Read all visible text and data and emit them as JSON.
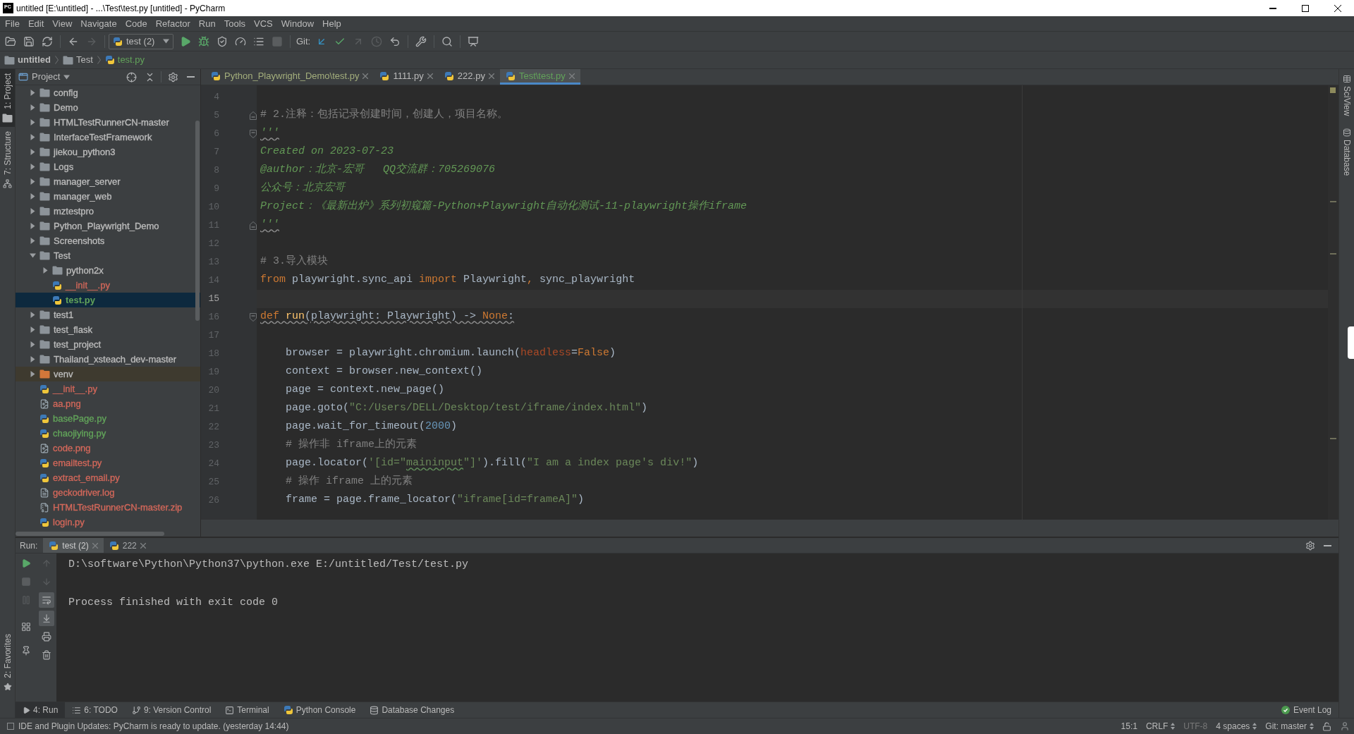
{
  "window": {
    "logo": "PC",
    "title": "untitled [E:\\untitled] - ...\\Test\\test.py [untitled] - PyCharm"
  },
  "menu": [
    "File",
    "Edit",
    "View",
    "Navigate",
    "Code",
    "Refactor",
    "Run",
    "Tools",
    "VCS",
    "Window",
    "Help"
  ],
  "toolbar": {
    "file_buttons": [
      {
        "disabled": false
      },
      {
        "disabled": false
      },
      {
        "disabled": false
      }
    ],
    "history_buttons": [
      {
        "disabled": false
      },
      {
        "disabled": true
      }
    ],
    "run_configuration": "test (2)",
    "run_buttons": [
      {
        "disabled": false
      },
      {
        "disabled": false
      },
      {
        "disabled": false
      },
      {
        "disabled": false
      },
      {
        "disabled": false
      },
      {
        "disabled": true
      }
    ],
    "vcs_label": "Git:",
    "vcs_buttons": [
      {
        "disabled": false
      },
      {
        "disabled": false
      },
      {
        "disabled": true
      },
      {
        "disabled": true
      },
      {
        "disabled": false
      }
    ],
    "tool_buttons": [
      {
        "disabled": false
      },
      {
        "disabled": false
      },
      {
        "disabled": false
      }
    ]
  },
  "navigation_bar": [
    {
      "label": "untitled",
      "kind": "project",
      "color": "#bbbbbb"
    },
    {
      "label": "Test",
      "kind": "folder",
      "color": "#bbbbbb"
    },
    {
      "label": "test.py",
      "kind": "python",
      "color": "#62a35a"
    }
  ],
  "tool_strip_left": {
    "top": [
      {
        "label": "1: Project",
        "selected": true
      },
      {
        "label": "7: Structure",
        "selected": false
      }
    ],
    "bottom": [
      {
        "label": "2: Favorites",
        "selected": false
      }
    ]
  },
  "project_panel": {
    "title": "Project",
    "tree": [
      {
        "label": "config",
        "kind": "folder",
        "color": "#bbbbbb",
        "expanded": false,
        "selected": false
      },
      {
        "label": "Demo",
        "kind": "folder",
        "color": "#bbbbbb",
        "expanded": false,
        "selected": false
      },
      {
        "label": "HTMLTestRunnerCN-master",
        "kind": "folder",
        "color": "#bbbbbb",
        "expanded": false,
        "selected": false
      },
      {
        "label": "InterfaceTestFramework",
        "kind": "folder",
        "color": "#bbbbbb",
        "expanded": false,
        "selected": false
      },
      {
        "label": "jiekou_python3",
        "kind": "folder",
        "color": "#bbbbbb",
        "expanded": false,
        "selected": false
      },
      {
        "label": "Logs",
        "kind": "folder",
        "color": "#bbbbbb",
        "expanded": false,
        "selected": false
      },
      {
        "label": "manager_server",
        "kind": "folder",
        "color": "#bbbbbb",
        "expanded": false,
        "selected": false
      },
      {
        "label": "manager_web",
        "kind": "folder",
        "color": "#bbbbbb",
        "expanded": false,
        "selected": false
      },
      {
        "label": "mztestpro",
        "kind": "folder",
        "color": "#bbbbbb",
        "expanded": false,
        "selected": false
      },
      {
        "label": "Python_Playwright_Demo",
        "kind": "folder",
        "color": "#bbbbbb",
        "expanded": false,
        "selected": false
      },
      {
        "label": "Screenshots",
        "kind": "folder",
        "color": "#bbbbbb",
        "expanded": false,
        "selected": false
      },
      {
        "label": "Test",
        "kind": "folder",
        "color": "#bbbbbb",
        "expanded": true,
        "selected": false,
        "children": [
          {
            "label": "python2x",
            "kind": "folder",
            "color": "#bbbbbb",
            "expanded": false,
            "selected": false
          },
          {
            "label": "__init__.py",
            "kind": "python",
            "color": "#d1675a",
            "selected": false
          },
          {
            "label": "test.py",
            "kind": "python",
            "color": "#62a35a",
            "selected": true
          }
        ]
      },
      {
        "label": "test1",
        "kind": "folder",
        "color": "#bbbbbb",
        "expanded": false,
        "selected": false
      },
      {
        "label": "test_flask",
        "kind": "folder",
        "color": "#bbbbbb",
        "expanded": false,
        "selected": false
      },
      {
        "label": "test_project",
        "kind": "folder",
        "color": "#bbbbbb",
        "expanded": false,
        "selected": false
      },
      {
        "label": "Thailand_xsteach_dev-master",
        "kind": "folder",
        "color": "#bbbbbb",
        "expanded": false,
        "selected": false
      },
      {
        "label": "venv",
        "kind": "excluded-folder",
        "color": "#bbbbbb",
        "expanded": false,
        "selected": false
      },
      {
        "label": "__init__.py",
        "kind": "python",
        "color": "#d1675a",
        "selected": false
      },
      {
        "label": "aa.png",
        "kind": "image",
        "color": "#d1675a",
        "selected": false
      },
      {
        "label": "basePage.py",
        "kind": "python",
        "color": "#62a35a",
        "selected": false
      },
      {
        "label": "chaojiying.py",
        "kind": "python",
        "color": "#62a35a",
        "selected": false
      },
      {
        "label": "code.png",
        "kind": "image",
        "color": "#d1675a",
        "selected": false
      },
      {
        "label": "emailtest.py",
        "kind": "python",
        "color": "#d1675a",
        "selected": false
      },
      {
        "label": "extract_email.py",
        "kind": "python",
        "color": "#d1675a",
        "selected": false
      },
      {
        "label": "geckodriver.log",
        "kind": "text",
        "color": "#d1675a",
        "selected": false
      },
      {
        "label": "HTMLTestRunnerCN-master.zip",
        "kind": "archive",
        "color": "#d1675a",
        "selected": false
      },
      {
        "label": "login.py",
        "kind": "python",
        "color": "#d1675a",
        "selected": false
      }
    ]
  },
  "editor": {
    "tabs": [
      {
        "label": "Python_Playwright_Demo\\test.py",
        "color": "#a3ae7c",
        "selected": false
      },
      {
        "label": "1111.py",
        "color": "#bbbbbb",
        "selected": false
      },
      {
        "label": "222.py",
        "color": "#bbbbbb",
        "selected": false
      },
      {
        "label": "Test\\test.py",
        "color": "#62a35a",
        "selected": true
      }
    ],
    "lines": [
      {
        "number": "4",
        "current": false
      },
      {
        "number": "5",
        "current": false,
        "fold_marker": {
          "kind": "end"
        },
        "tokens": [
          {
            "text": "# 2.注释：包括记录创建时间，创建人，项目名称。",
            "kind": "comment",
            "warning": false
          }
        ]
      },
      {
        "number": "6",
        "current": false,
        "fold_marker": {
          "kind": "start"
        },
        "tokens": [
          {
            "text": "'''",
            "kind": "docstring",
            "warning": true
          }
        ]
      },
      {
        "number": "7",
        "current": false,
        "tokens": [
          {
            "text": "Created on 2023-07-23",
            "kind": "docstring",
            "warning": false
          }
        ]
      },
      {
        "number": "8",
        "current": false,
        "tokens": [
          {
            "text": "@author：北京-宏哥   QQ交流群：705269076",
            "kind": "docstring",
            "warning": false
          }
        ]
      },
      {
        "number": "9",
        "current": false,
        "tokens": [
          {
            "text": "公众号：北京宏哥",
            "kind": "docstring",
            "warning": false
          }
        ]
      },
      {
        "number": "10",
        "current": false,
        "tokens": [
          {
            "text": "Project：《最新出炉》系列初窥篇-Python+Playwright自动化测试-11-playwright操作iframe",
            "kind": "docstring",
            "warning": false
          }
        ]
      },
      {
        "number": "11",
        "current": false,
        "fold_marker": {
          "kind": "end"
        },
        "tokens": [
          {
            "text": "'''",
            "kind": "docstring",
            "warning": true
          }
        ]
      },
      {
        "number": "12",
        "current": false
      },
      {
        "number": "13",
        "current": false,
        "tokens": [
          {
            "text": "# 3.导入模块",
            "kind": "comment",
            "warning": false
          }
        ]
      },
      {
        "number": "14",
        "current": false,
        "tokens": [
          {
            "text": "from",
            "kind": "keyword",
            "warning": false
          },
          {
            "text": " playwright.sync_api ",
            "kind": "plain",
            "warning": false
          },
          {
            "text": "import",
            "kind": "keyword",
            "warning": false
          },
          {
            "text": " Playwright",
            "kind": "plain",
            "warning": false
          },
          {
            "text": ",",
            "kind": "punct",
            "warning": false
          },
          {
            "text": " sync_playwright",
            "kind": "plain",
            "warning": false
          }
        ]
      },
      {
        "number": "15",
        "current": true
      },
      {
        "number": "16",
        "current": false,
        "fold_marker": {
          "kind": "start"
        },
        "tokens": [
          {
            "text": "def ",
            "kind": "keyword",
            "warning": true
          },
          {
            "text": "run",
            "kind": "function",
            "warning": true
          },
          {
            "text": "(playwright: Playwright) -> ",
            "kind": "plain",
            "warning": true
          },
          {
            "text": "None",
            "kind": "keyword",
            "warning": true
          },
          {
            "text": ":",
            "kind": "plain",
            "warning": true
          }
        ]
      },
      {
        "number": "17",
        "current": false
      },
      {
        "number": "18",
        "current": false,
        "tokens": [
          {
            "text": "    browser = playwright.chromium.launch(",
            "kind": "plain",
            "warning": false
          },
          {
            "text": "headless",
            "kind": "param",
            "warning": false
          },
          {
            "text": "=",
            "kind": "plain",
            "warning": false
          },
          {
            "text": "False",
            "kind": "keyword",
            "warning": false
          },
          {
            "text": ")",
            "kind": "plain",
            "warning": false
          }
        ]
      },
      {
        "number": "19",
        "current": false,
        "tokens": [
          {
            "text": "    context = browser.new_context()",
            "kind": "plain",
            "warning": false
          }
        ]
      },
      {
        "number": "20",
        "current": false,
        "tokens": [
          {
            "text": "    page = context.new_page()",
            "kind": "plain",
            "warning": false
          }
        ]
      },
      {
        "number": "21",
        "current": false,
        "tokens": [
          {
            "text": "    page.goto(",
            "kind": "plain",
            "warning": false
          },
          {
            "text": "\"C:/Users/DELL/Desktop/test/iframe/index.html\"",
            "kind": "string",
            "warning": false
          },
          {
            "text": ")",
            "kind": "plain",
            "warning": false
          }
        ]
      },
      {
        "number": "22",
        "current": false,
        "tokens": [
          {
            "text": "    page.wait_for_timeout(",
            "kind": "plain",
            "warning": false
          },
          {
            "text": "2000",
            "kind": "number",
            "warning": false
          },
          {
            "text": ")",
            "kind": "plain",
            "warning": false
          }
        ]
      },
      {
        "number": "23",
        "current": false,
        "tokens": [
          {
            "text": "    # 操作非 iframe上的元素",
            "kind": "comment",
            "warning": false
          }
        ]
      },
      {
        "number": "24",
        "current": false,
        "tokens": [
          {
            "text": "    page.locator(",
            "kind": "plain",
            "warning": false
          },
          {
            "text": "'[id=\"",
            "kind": "string",
            "warning": false
          },
          {
            "text": "maininput",
            "kind": "string",
            "warning": true
          },
          {
            "text": "\"]'",
            "kind": "string",
            "warning": false
          },
          {
            "text": ").fill(",
            "kind": "plain",
            "warning": false
          },
          {
            "text": "\"I am a index page's div!\"",
            "kind": "string",
            "warning": false
          },
          {
            "text": ")",
            "kind": "plain",
            "warning": false
          }
        ]
      },
      {
        "number": "25",
        "current": false,
        "tokens": [
          {
            "text": "    # 操作 iframe 上的元素",
            "kind": "comment",
            "warning": false
          }
        ]
      },
      {
        "number": "26",
        "current": false,
        "tokens": [
          {
            "text": "    frame = page.frame_locator(",
            "kind": "plain",
            "warning": false
          },
          {
            "text": "\"iframe[id=frameA]\"",
            "kind": "string",
            "warning": false
          },
          {
            "text": ")",
            "kind": "plain",
            "warning": false
          }
        ]
      }
    ]
  },
  "tool_strip_right": [
    {
      "label": "SciView"
    },
    {
      "label": "Database"
    }
  ],
  "run_panel": {
    "label": "Run:",
    "tabs": [
      {
        "label": "test (2)",
        "selected": true
      },
      {
        "label": "222",
        "selected": false
      }
    ],
    "controls": [
      {
        "disabled": false
      },
      {
        "disabled": true
      },
      {
        "disabled": true
      },
      {
        "disabled": false
      },
      {
        "disabled": false
      }
    ],
    "options": [
      {
        "disabled": true,
        "on": false
      },
      {
        "disabled": true,
        "on": false
      },
      {
        "disabled": false,
        "on": true
      },
      {
        "disabled": false,
        "on": true
      },
      {
        "disabled": false,
        "on": false
      },
      {
        "disabled": false,
        "on": false
      }
    ],
    "console": [
      {
        "text": "D:\\software\\Python\\Python37\\python.exe E:/untitled/Test/test.py",
        "kind": "command"
      },
      {
        "text": "Process finished with exit code 0",
        "kind": "exit"
      }
    ]
  },
  "tool_window_bar": {
    "items": [
      {
        "label": "4: Run",
        "selected": true
      },
      {
        "label": "6: TODO",
        "selected": false
      },
      {
        "label": "9: Version Control",
        "selected": false
      },
      {
        "label": "Terminal",
        "selected": false
      },
      {
        "label": "Python Console",
        "selected": false
      },
      {
        "label": "Database Changes",
        "selected": false
      }
    ],
    "event_log": "Event Log"
  },
  "status_bar": {
    "message": "IDE and Plugin Updates: PyCharm is ready to update. (yesterday 14:44)",
    "items": [
      {
        "label": "15:1",
        "kind": "text",
        "disabled": false
      },
      {
        "label": "CRLF",
        "kind": "selector",
        "disabled": false
      },
      {
        "label": "UTF-8",
        "kind": "text",
        "disabled": true
      },
      {
        "label": "4 spaces",
        "kind": "selector",
        "disabled": false
      },
      {
        "label": "Git: master",
        "kind": "selector",
        "disabled": false
      }
    ]
  }
}
